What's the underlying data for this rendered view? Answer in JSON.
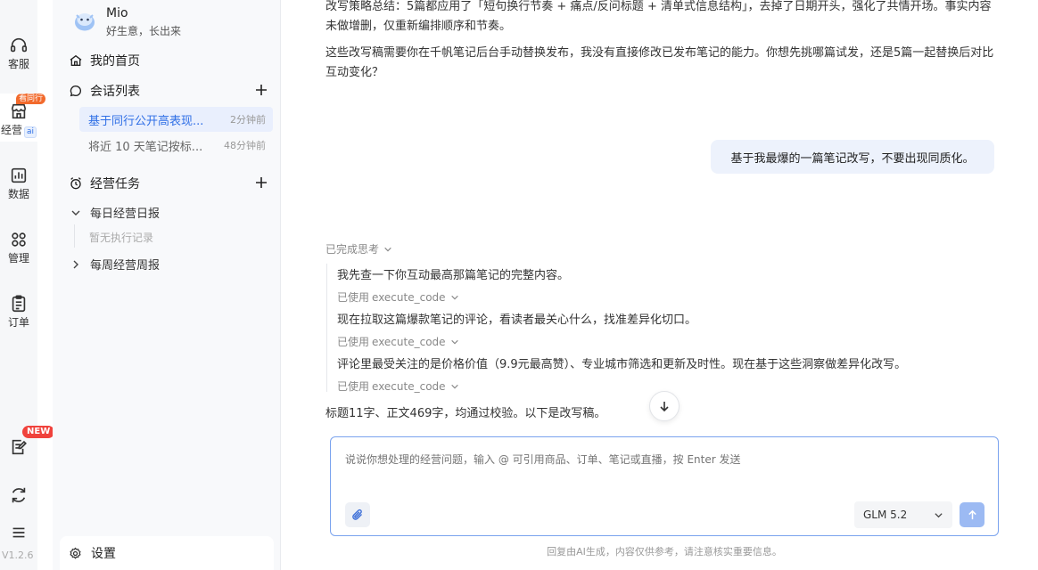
{
  "rail": {
    "service_label": "客服",
    "business_label": "经营",
    "business_badge": "看同行",
    "business_ai": "ai",
    "data_label": "数据",
    "manage_label": "管理",
    "orders_label": "订单",
    "new_badge": "NEW",
    "version": "V1.2.6"
  },
  "sidebar": {
    "profile_name": "Mio",
    "profile_motto": "好生意，长出来",
    "home_label": "我的首页",
    "conversations_label": "会话列表",
    "conversations": [
      {
        "title": "基于同行公开高表现...",
        "time": "2分钟前"
      },
      {
        "title": "将近 10 天笔记按标...",
        "time": "48分钟前"
      }
    ],
    "tasks_label": "经营任务",
    "daily_report_label": "每日经营日报",
    "daily_empty": "暂无执行记录",
    "weekly_report_label": "每周经营周报",
    "settings_label": "设置"
  },
  "chat": {
    "para1": "改写策略总结：5篇都应用了「短句换行节奏 + 痛点/反问标题 + 清单式信息结构」，去掉了日期开头，强化了共情开场。事实内容未做增删，仅重新编排顺序和节奏。",
    "para2": "这些改写稿需要你在千帆笔记后台手动替换发布，我没有直接修改已发布笔记的能力。你想先挑哪篇试发，还是5篇一起替换后对比互动变化？",
    "user_message": "基于我最爆的一篇笔记改写，不要出现同质化。",
    "thought_header": "已完成思考",
    "thought_1": "我先查一下你互动最高那篇笔记的完整内容。",
    "tool_used_prefix": "已使用",
    "tool_name": "execute_code",
    "thought_2": "现在拉取这篇爆款笔记的评论，看读者最关心什么，找准差异化切口。",
    "thought_3": "评论里最受关注的是价格价值（9.9元最高赞）、专业城市筛选和更新及时性。现在基于这些洞察做差异化改写。",
    "result": "标题11字、正文469字，均通过校验。以下是改写稿。"
  },
  "composer": {
    "placeholder": "说说你想处理的经营问题，输入 @ 可引用商品、订单、笔记或直播，按 Enter 发送",
    "model": "GLM 5.2",
    "disclaimer": "回复由AI生成，内容仅供参考，请注意核实重要信息。"
  }
}
